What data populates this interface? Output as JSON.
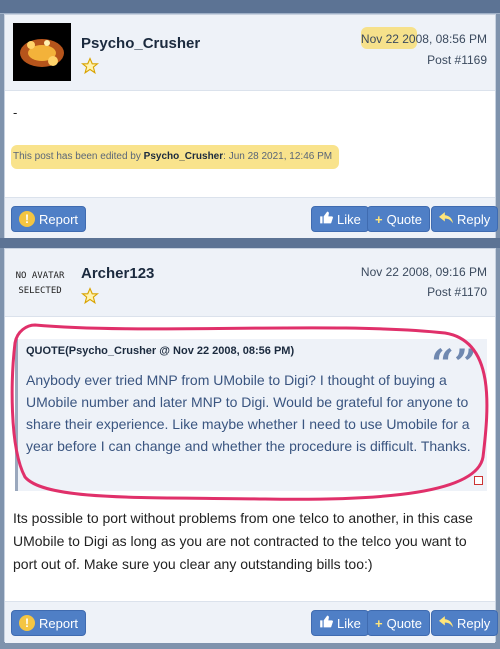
{
  "post1": {
    "username": "Psycho_Crusher",
    "date": "Nov 22 2008, 08:56 PM",
    "post_number": "Post #1169",
    "body": "-",
    "edit_note": "This post has been edited by",
    "edit_user": "Psycho_Crusher",
    "edit_time": ": Jun 28 2021, 12:46 PM"
  },
  "post2": {
    "username": "Archer123",
    "avatar_text_line1": "NO AVATAR",
    "avatar_text_line2": "SELECTED",
    "date": "Nov 22 2008, 09:16 PM",
    "post_number": "Post #1170",
    "quote_title": "QUOTE(Psycho_Crusher @ Nov 22 2008, 08:56 PM)",
    "quote_text": "Anybody ever tried MNP from UMobile to Digi? I thought of buying a UMobile number and later MNP to Digi. Would be grateful for anyone to share their experience. Like maybe whether I need to use Umobile for a year before I can change and whether the procedure is difficult. Thanks.",
    "reply": "Its possible to port without problems from one telco to another, in this case UMobile to Digi as long as you are not contracted to the telco you want to port out of. Make sure you clear any outstanding bills too:)"
  },
  "buttons": {
    "report": "Report",
    "like": "Like",
    "quote": "Quote",
    "reply": "Reply"
  },
  "icons": {
    "report": "exclamation-icon",
    "like": "thumbs-up-icon",
    "quote": "plus-icon",
    "reply": "reply-arrow-icon",
    "rank": "star-icon"
  },
  "colors": {
    "accent": "#4f7fc6",
    "highlight": "#f7dc6f",
    "annotation": "#e0306a"
  }
}
